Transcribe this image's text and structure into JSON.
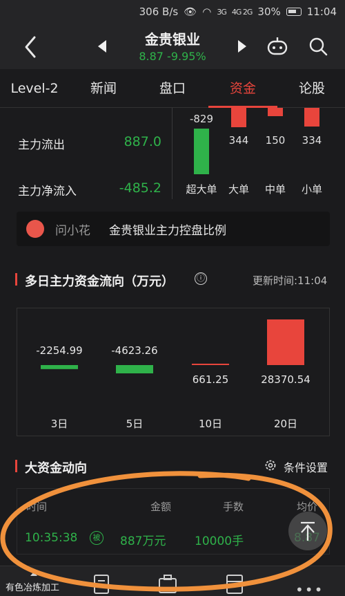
{
  "status_bar": {
    "speed": "306 B/s",
    "battery": "30%",
    "time": "11:04",
    "signal1": "3G",
    "signal2": "4G 2G"
  },
  "header": {
    "stock_name": "金贵银业",
    "price_line": "8.87  -9.95%"
  },
  "tabs": [
    "Level-2",
    "新闻",
    "盘口",
    "资金",
    "论股"
  ],
  "active_tab": "资金",
  "main_flow": {
    "outflow_label": "主力流出",
    "outflow_value": "887.0",
    "net_label": "主力净流入",
    "net_value": "-485.2"
  },
  "order_size_chart": {
    "items": [
      {
        "label": "超大单",
        "value": -829,
        "text": "-829"
      },
      {
        "label": "大单",
        "value": 344,
        "text": "344"
      },
      {
        "label": "中单",
        "value": 150,
        "text": "150"
      },
      {
        "label": "小单",
        "value": 334,
        "text": "334"
      }
    ]
  },
  "ai_bar": {
    "name": "问小花",
    "question": "金贵银业主力控盘比例"
  },
  "multi_day": {
    "title": "多日主力资金流向（万元）",
    "info_icon": "ⓘ",
    "update_time": "更新时间:11:04",
    "items": [
      {
        "label": "3日",
        "value": -2254.99,
        "text": "-2254.99"
      },
      {
        "label": "5日",
        "value": -4623.26,
        "text": "-4623.26"
      },
      {
        "label": "10日",
        "value": 661.25,
        "text": "661.25"
      },
      {
        "label": "20日",
        "value": 28370.54,
        "text": "28370.54"
      }
    ]
  },
  "big_money": {
    "title": "大资金动向",
    "settings_label": "条件设置",
    "columns": [
      "时间",
      "金额",
      "手数",
      "均价"
    ],
    "row": {
      "time": "10:35:38",
      "tag": "被",
      "amount": "887万元",
      "lots": "10000手",
      "avg": "8.87"
    }
  },
  "bottom_nav": {
    "industry": "有色冶炼加工"
  },
  "colors": {
    "up": "#e8453c",
    "down": "#2fb24a",
    "annotation": "#f0913c",
    "bg": "#1b1b1d"
  },
  "icons": [
    "back-icon",
    "prev-stock-icon",
    "next-stock-icon",
    "robot-icon",
    "search-icon",
    "info-icon",
    "gear-icon",
    "scroll-top-icon"
  ]
}
